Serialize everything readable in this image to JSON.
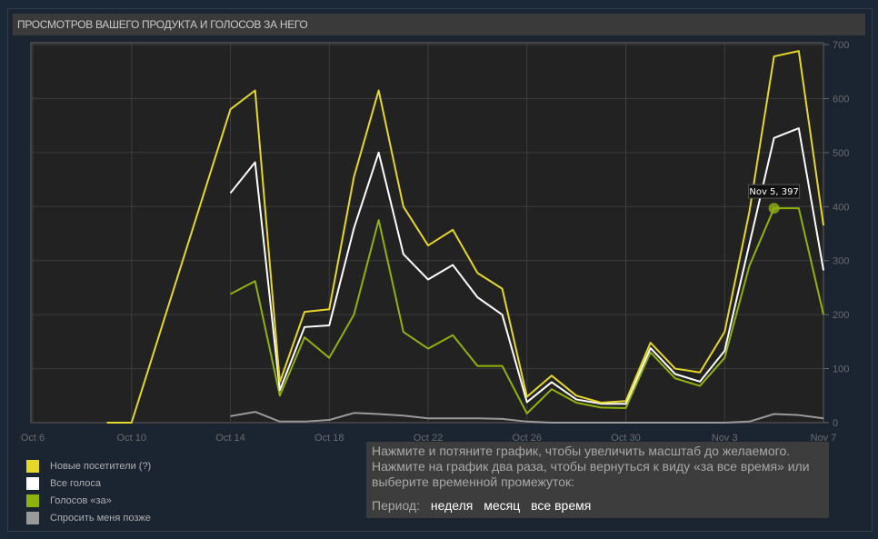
{
  "title": "ПРОСМОТРОВ ВАШЕГО ПРОДУКТА И ГОЛОСОВ ЗА НЕГО",
  "chart_data": {
    "type": "line",
    "x_unit": "days since Oct 6",
    "xlim": [
      0,
      32
    ],
    "ylim": [
      0,
      700
    ],
    "x_ticks": [
      {
        "day": 0,
        "label": "Oct 6"
      },
      {
        "day": 4,
        "label": "Oct 10"
      },
      {
        "day": 8,
        "label": "Oct 14"
      },
      {
        "day": 12,
        "label": "Oct 18"
      },
      {
        "day": 16,
        "label": "Oct 22"
      },
      {
        "day": 20,
        "label": "Oct 26"
      },
      {
        "day": 24,
        "label": "Oct 30"
      },
      {
        "day": 28,
        "label": "Nov 3"
      },
      {
        "day": 32,
        "label": "Nov 7"
      }
    ],
    "y_ticks": [
      0,
      100,
      200,
      300,
      400,
      500,
      600,
      700
    ],
    "grid": true,
    "legend_position": "bottom-left",
    "series": [
      {
        "name": "Новые посетители (?)",
        "color": "#e6d72a",
        "points": [
          [
            3,
            0
          ],
          [
            4,
            0
          ],
          [
            8,
            580
          ],
          [
            9,
            615
          ],
          [
            10,
            75
          ],
          [
            11,
            205
          ],
          [
            12,
            210
          ],
          [
            13,
            455
          ],
          [
            14,
            615
          ],
          [
            15,
            400
          ],
          [
            16,
            328
          ],
          [
            17,
            357
          ],
          [
            18,
            277
          ],
          [
            19,
            248
          ],
          [
            20,
            48
          ],
          [
            21,
            87
          ],
          [
            22,
            50
          ],
          [
            23,
            37
          ],
          [
            24,
            40
          ],
          [
            25,
            148
          ],
          [
            26,
            100
          ],
          [
            27,
            93
          ],
          [
            28,
            168
          ],
          [
            29,
            390
          ],
          [
            30,
            678
          ],
          [
            31,
            688
          ],
          [
            32,
            365
          ]
        ]
      },
      {
        "name": "Все голоса",
        "color": "#ffffff",
        "points": [
          [
            8,
            425
          ],
          [
            9,
            482
          ],
          [
            10,
            60
          ],
          [
            11,
            177
          ],
          [
            12,
            180
          ],
          [
            13,
            360
          ],
          [
            14,
            500
          ],
          [
            15,
            312
          ],
          [
            16,
            265
          ],
          [
            17,
            292
          ],
          [
            18,
            232
          ],
          [
            19,
            200
          ],
          [
            20,
            38
          ],
          [
            21,
            75
          ],
          [
            22,
            43
          ],
          [
            23,
            35
          ],
          [
            24,
            35
          ],
          [
            25,
            138
          ],
          [
            26,
            90
          ],
          [
            27,
            76
          ],
          [
            28,
            133
          ],
          [
            29,
            330
          ],
          [
            30,
            527
          ],
          [
            31,
            545
          ],
          [
            32,
            282
          ]
        ]
      },
      {
        "name": "Голосов «за»",
        "color": "#90b20c",
        "points": [
          [
            8,
            238
          ],
          [
            9,
            262
          ],
          [
            10,
            50
          ],
          [
            11,
            158
          ],
          [
            12,
            120
          ],
          [
            13,
            200
          ],
          [
            14,
            375
          ],
          [
            15,
            168
          ],
          [
            16,
            137
          ],
          [
            17,
            162
          ],
          [
            18,
            105
          ],
          [
            19,
            105
          ],
          [
            20,
            17
          ],
          [
            21,
            62
          ],
          [
            22,
            37
          ],
          [
            23,
            28
          ],
          [
            24,
            27
          ],
          [
            25,
            130
          ],
          [
            26,
            82
          ],
          [
            27,
            68
          ],
          [
            28,
            120
          ],
          [
            29,
            290
          ],
          [
            30,
            397
          ],
          [
            31,
            397
          ],
          [
            32,
            200
          ]
        ]
      },
      {
        "name": "Спросить меня позже",
        "color": "#9a9a9a",
        "points": [
          [
            8,
            12
          ],
          [
            9,
            20
          ],
          [
            10,
            2
          ],
          [
            11,
            2
          ],
          [
            12,
            5
          ],
          [
            13,
            18
          ],
          [
            14,
            16
          ],
          [
            15,
            13
          ],
          [
            16,
            8
          ],
          [
            17,
            8
          ],
          [
            18,
            8
          ],
          [
            19,
            7
          ],
          [
            20,
            2
          ],
          [
            21,
            0
          ],
          [
            22,
            0
          ],
          [
            23,
            0
          ],
          [
            24,
            0
          ],
          [
            25,
            0
          ],
          [
            26,
            0
          ],
          [
            27,
            0
          ],
          [
            28,
            0
          ],
          [
            29,
            2
          ],
          [
            30,
            16
          ],
          [
            31,
            14
          ],
          [
            32,
            8
          ]
        ]
      }
    ],
    "tooltip": {
      "series": 2,
      "day": 30,
      "label": "Nov 5, 397"
    }
  },
  "info": {
    "line1": "Нажмите и потяните график, чтобы увеличить масштаб до желаемого.",
    "line2": "Нажмите на график два раза, чтобы вернуться к виду «за все время» или выберите временной промежуток:",
    "period_label": "Период:",
    "periods": [
      "неделя",
      "месяц",
      "все время"
    ]
  }
}
